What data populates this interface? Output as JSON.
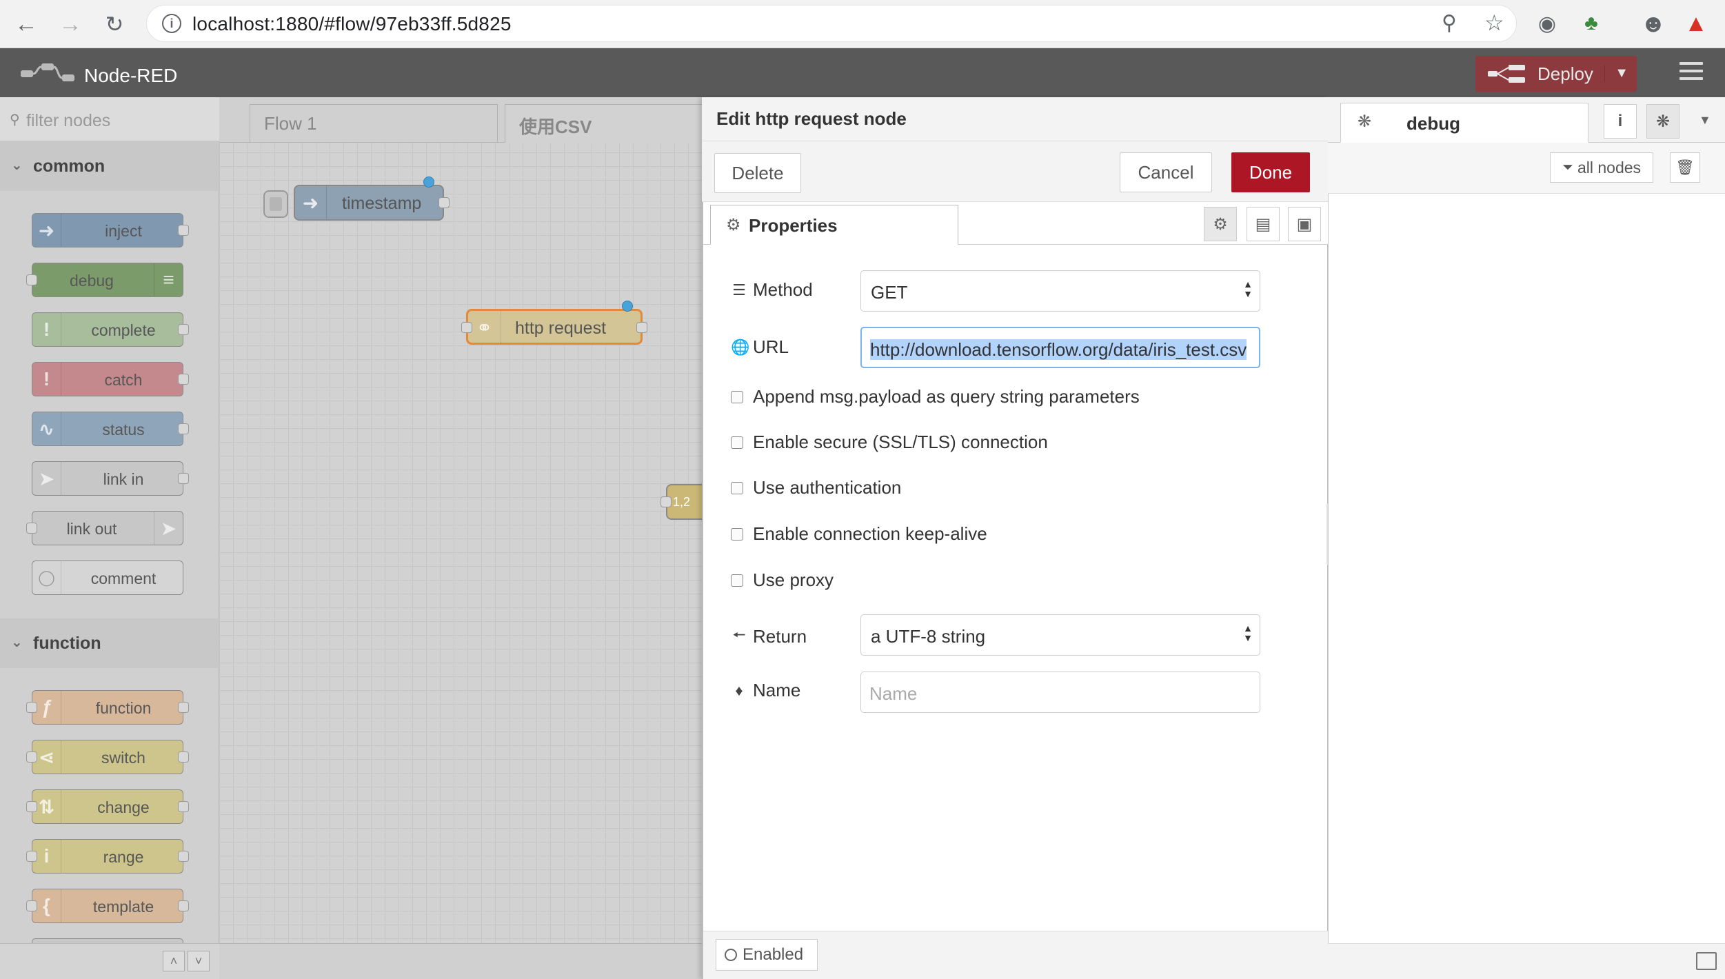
{
  "browser": {
    "url": "localhost:1880/#flow/97eb33ff.5d825"
  },
  "app": {
    "title": "Node-RED",
    "deploy_label": "Deploy"
  },
  "palette": {
    "filter_placeholder": "filter nodes",
    "categories": [
      {
        "name": "common",
        "nodes": [
          "inject",
          "debug",
          "complete",
          "catch",
          "status",
          "link in",
          "link out",
          "comment"
        ]
      },
      {
        "name": "function",
        "nodes": [
          "function",
          "switch",
          "change",
          "range",
          "template"
        ]
      }
    ]
  },
  "workspace": {
    "tabs": [
      "Flow 1",
      "使用CSV"
    ],
    "nodes": [
      "timestamp",
      "http request",
      "1,2"
    ]
  },
  "tray": {
    "title": "Edit http request node",
    "delete_label": "Delete",
    "cancel_label": "Cancel",
    "done_label": "Done",
    "properties_tab": "Properties",
    "method_label": "Method",
    "method_value": "GET",
    "url_label": "URL",
    "url_value": "http://download.tensorflow.org/data/iris_test.csv",
    "checkboxes": [
      "Append msg.payload as query string parameters",
      "Enable secure (SSL/TLS) connection",
      "Use authentication",
      "Enable connection keep-alive",
      "Use proxy"
    ],
    "return_label": "Return",
    "return_value": "a UTF-8 string",
    "name_label": "Name",
    "name_placeholder": "Name",
    "enabled_label": "Enabled"
  },
  "sidebar": {
    "debug_tab": "debug",
    "filter_label": "all nodes"
  },
  "colors": {
    "deploy": "#8c3a3e",
    "done": "#ad1625",
    "header": "#595959"
  }
}
